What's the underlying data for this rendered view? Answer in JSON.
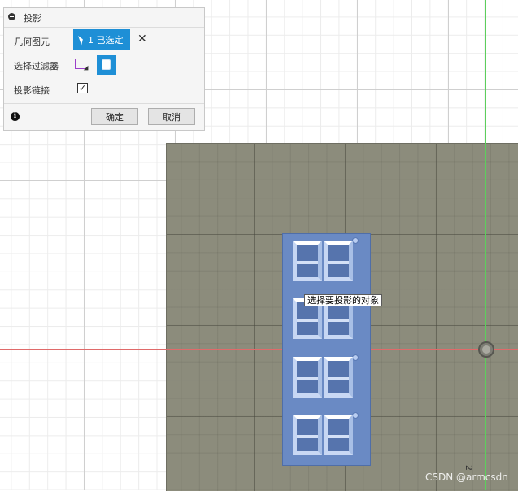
{
  "dialog": {
    "title": "投影",
    "geometry_label": "几何图元",
    "geometry_selection": "1 已选定",
    "filter_label": "选择过滤器",
    "projection_link_label": "投影链接",
    "projection_link_checked": "✓",
    "ok_label": "确定",
    "cancel_label": "取消",
    "info_glyph": "i",
    "clear_glyph": "✕"
  },
  "viewport": {
    "tooltip": "选择要投影的对象",
    "coordinate_label": "2",
    "watermark": "CSDN @armcsdn"
  },
  "colors": {
    "accent": "#1e8fd6",
    "plane": "#8c8c7c",
    "part": "#6a8ac4",
    "x_axis": "#e06a6a",
    "y_axis": "#5ccf5c"
  }
}
